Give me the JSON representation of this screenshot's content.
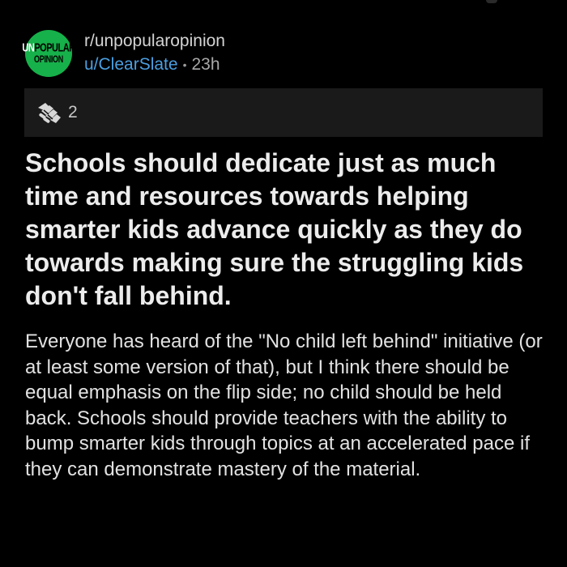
{
  "post": {
    "subreddit": "r/unpopularopinion",
    "author": "u/ClearSlate",
    "separator": "•",
    "age": "23h",
    "avatar": {
      "line1_prefix": "UN",
      "line1_rest": "POPULAR",
      "line2": "OPINION",
      "color": "#16b14a"
    },
    "awards": {
      "icon": "hands-award-icon",
      "count": "2"
    },
    "title": "Schools should dedicate just as much time and resources towards helping smarter kids advance quickly as they do towards making sure the struggling kids don't fall behind.",
    "body": "Everyone has heard of the \"No child left behind\" initiative (or at least some version of that), but I think there should be equal emphasis on the flip side; no child should be held back. Schools should provide teachers with the ability to bump smarter kids through topics at an accelerated pace if they can demonstrate mastery of the material."
  },
  "colors": {
    "background": "#000000",
    "username": "#4b9fe1",
    "award_bar": "#1a1a1a"
  }
}
